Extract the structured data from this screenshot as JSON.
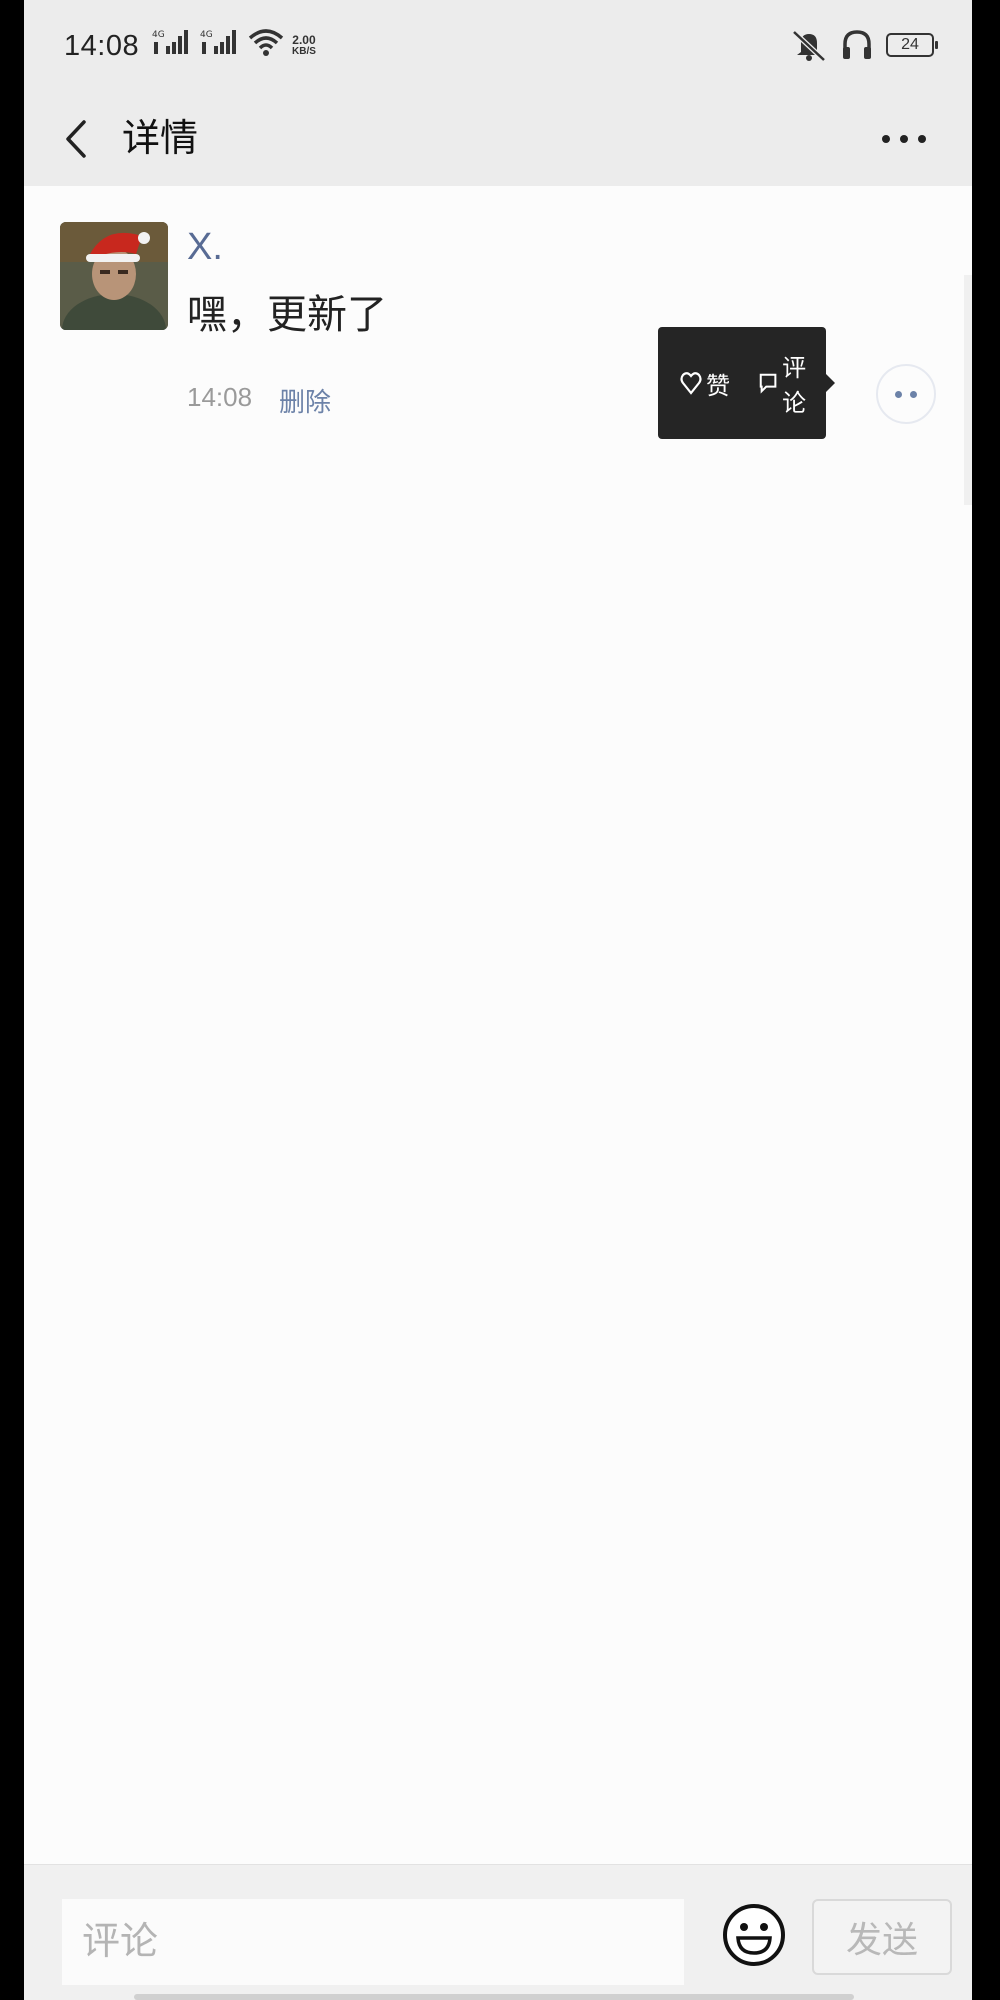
{
  "status_bar": {
    "time": "14:08",
    "signal_1_icon": "signal-4g-icon",
    "signal_2_icon": "signal-4g-icon",
    "wifi_icon": "wifi-icon",
    "net_speed_value": "2.00",
    "net_speed_unit": "KB/S",
    "mute_icon": "bell-off-icon",
    "headset_icon": "headphones-icon",
    "battery": "24"
  },
  "header": {
    "title": "详情",
    "back_icon": "chevron-left-icon",
    "more_icon": "more-dots-icon"
  },
  "post": {
    "username": "X.",
    "text": "嘿，更新了",
    "time": "14:08",
    "delete_label": "删除",
    "avatar_icon": "user-avatar"
  },
  "action_popup": {
    "like_label": "赞",
    "comment_label": "评论",
    "like_icon": "heart-icon",
    "comment_icon": "comment-icon"
  },
  "input_bar": {
    "placeholder": "评论",
    "send_label": "发送",
    "emoji_icon": "smiley-icon"
  },
  "colors": {
    "accent_link": "#6c82a8",
    "username": "#586b94",
    "header_bg": "#ececec",
    "popup_bg": "#252525"
  }
}
